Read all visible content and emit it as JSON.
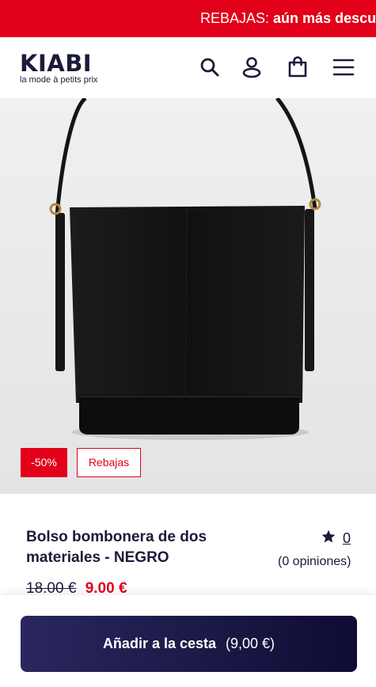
{
  "promo": {
    "prefix": "REBAJAS:",
    "highlight": "aún más descu"
  },
  "header": {
    "logo_text": "KIABI",
    "logo_tagline": "la mode à petits prix",
    "icons": [
      "search-icon",
      "account-icon",
      "bag-icon",
      "menu-icon"
    ]
  },
  "product": {
    "badges": {
      "discount": "-50%",
      "sale": "Rebajas"
    },
    "title": "Bolso bombonera de dos materiales - NEGRO",
    "rating_count": "0",
    "reviews": "(0 opiniones)",
    "old_price": "18.00 €",
    "new_price": "9.00 €"
  },
  "cart": {
    "button_label": "Añadir a la cesta",
    "button_price": "(9,00 €)"
  },
  "colors": {
    "brand_red": "#e2001a",
    "navy": "#1b1b3a"
  }
}
